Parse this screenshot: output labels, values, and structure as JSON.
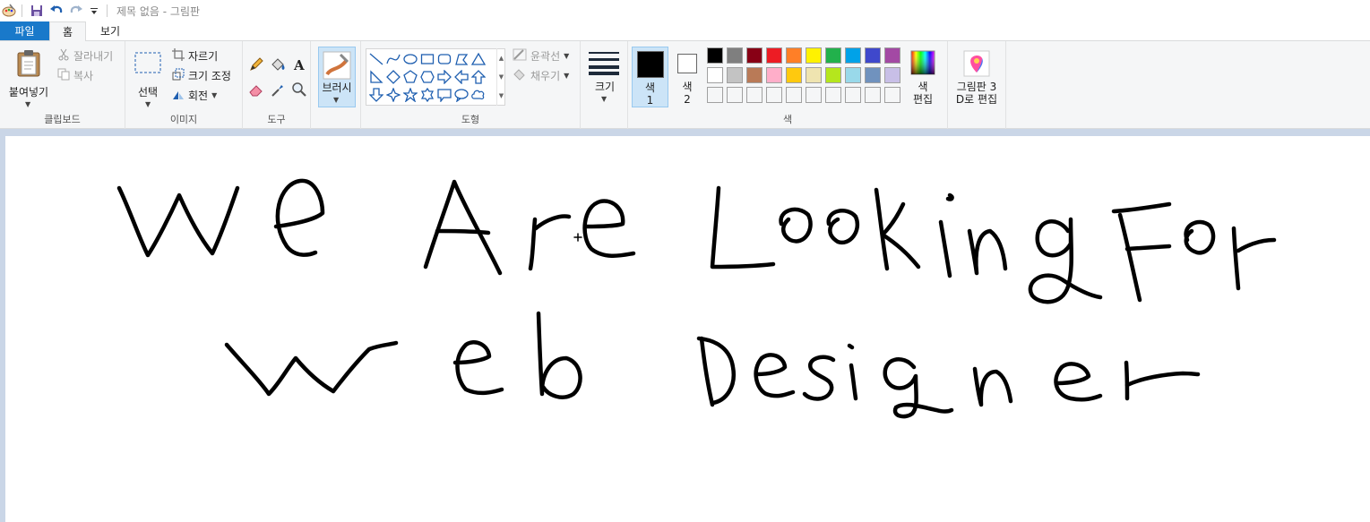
{
  "window": {
    "title": "제목 없음 - 그림판"
  },
  "tabs": {
    "file": "파일",
    "home": "홈",
    "view": "보기"
  },
  "clipboard": {
    "paste": "붙여넣기",
    "cut": "잘라내기",
    "copy": "복사",
    "label": "클립보드"
  },
  "image": {
    "select": "선택",
    "crop": "자르기",
    "resize": "크기 조정",
    "rotate": "회전",
    "label": "이미지"
  },
  "tools": {
    "label": "도구"
  },
  "brushes": {
    "label": "브러시"
  },
  "shapes": {
    "outline": "윤곽선",
    "fill": "채우기",
    "label": "도형"
  },
  "size": {
    "label": "크기"
  },
  "colors": {
    "color1_line1": "색",
    "color1_line2": "1",
    "color2_line1": "색",
    "color2_line2": "2",
    "edit_line1": "색",
    "edit_line2": "편집",
    "label": "색",
    "color1": "#000000",
    "color2": "#ffffff",
    "palette_row1": [
      "#000000",
      "#7f7f7f",
      "#880015",
      "#ed1c24",
      "#ff7f27",
      "#fff200",
      "#22b14c",
      "#00a2e8",
      "#3f48cc",
      "#a349a4"
    ],
    "palette_row2": [
      "#ffffff",
      "#c3c3c3",
      "#b97a57",
      "#ffaec9",
      "#ffc90e",
      "#efe4b0",
      "#b5e61d",
      "#99d9ea",
      "#7092be",
      "#c8bfe7"
    ],
    "palette_row3": [
      "#f5f6f7",
      "#f5f6f7",
      "#f5f6f7",
      "#f5f6f7",
      "#f5f6f7",
      "#f5f6f7",
      "#f5f6f7",
      "#f5f6f7",
      "#f5f6f7",
      "#f5f6f7"
    ]
  },
  "paint3d": {
    "line1": "그림판 3",
    "line2": "D로 편집"
  },
  "drawing": {
    "line1": "We Are Looking For",
    "line2": "web Designer"
  }
}
